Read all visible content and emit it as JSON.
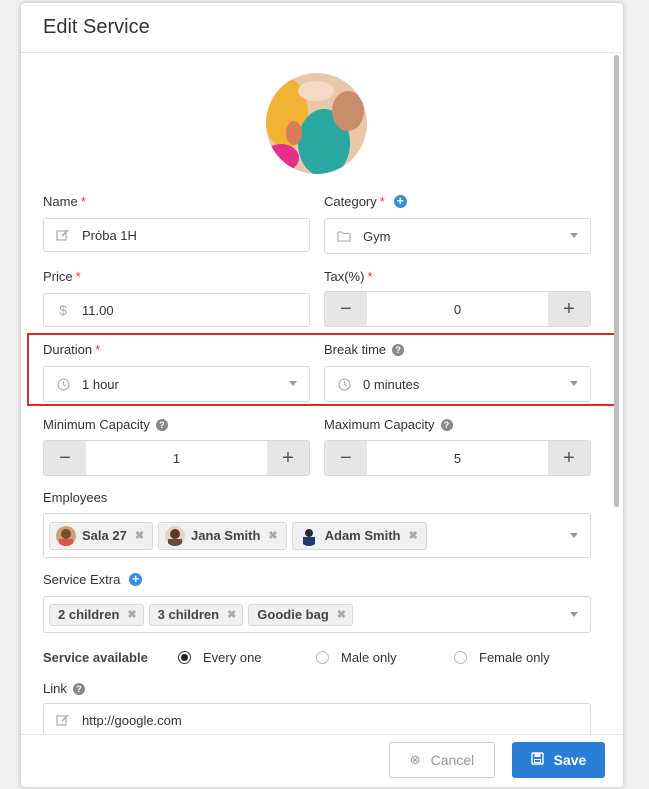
{
  "modal": {
    "title": "Edit Service"
  },
  "name": {
    "label": "Name",
    "required": "*",
    "value": "Próba 1H"
  },
  "category": {
    "label": "Category",
    "required": "*",
    "value": "Gym"
  },
  "price": {
    "label": "Price",
    "required": "*",
    "currency": "$",
    "value": "11.00"
  },
  "tax": {
    "label": "Tax(%)",
    "required": "*",
    "value": "0",
    "minus": "−",
    "plus": "+"
  },
  "duration": {
    "label": "Duration",
    "required": "*",
    "value": "1 hour"
  },
  "break_time": {
    "label": "Break time",
    "value": "0 minutes"
  },
  "min_capacity": {
    "label": "Minimum Capacity",
    "value": "1",
    "minus": "−",
    "plus": "+"
  },
  "max_capacity": {
    "label": "Maximum Capacity",
    "value": "5",
    "minus": "−",
    "plus": "+"
  },
  "employees": {
    "label": "Employees",
    "tags": [
      "Sala 27",
      "Jana Smith",
      "Adam Smith"
    ]
  },
  "service_extra": {
    "label": "Service Extra",
    "tags": [
      "2 children",
      "3 children",
      "Goodie bag"
    ]
  },
  "availability": {
    "label": "Service available",
    "options": [
      "Every one",
      "Male only",
      "Female only"
    ],
    "selected": "Every one"
  },
  "link": {
    "label": "Link",
    "value": "http://google.com"
  },
  "footer": {
    "cancel_label": "Cancel",
    "save_label": "Save"
  },
  "colors": {
    "accent": "#2a7fd4",
    "required": "#e53935",
    "highlight": "#d32f2f"
  }
}
